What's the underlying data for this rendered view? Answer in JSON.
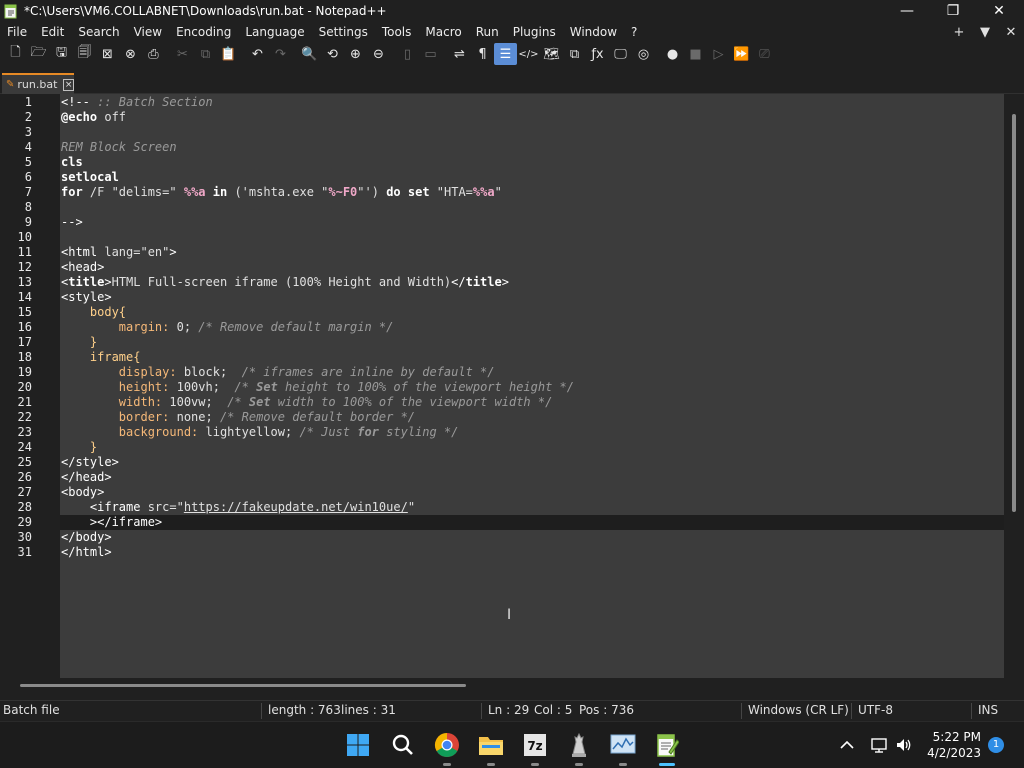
{
  "window": {
    "title": "*C:\\Users\\VM6.COLLABNET\\Downloads\\run.bat - Notepad++",
    "minimize_icon": "minimize-icon",
    "maximize_icon": "restore-icon",
    "close_icon": "close-icon"
  },
  "menu": {
    "items": [
      "File",
      "Edit",
      "Search",
      "View",
      "Encoding",
      "Language",
      "Settings",
      "Tools",
      "Macro",
      "Run",
      "Plugins",
      "Window",
      "?"
    ],
    "right": [
      "+",
      "▼",
      "✕"
    ]
  },
  "toolbar": {
    "buttons": [
      {
        "name": "new-file",
        "glyph": "🗋",
        "dim": false
      },
      {
        "name": "open-file",
        "glyph": "🗁",
        "dim": false
      },
      {
        "name": "save",
        "glyph": "🖫",
        "dim": false
      },
      {
        "name": "save-all",
        "glyph": "🗐",
        "dim": false
      },
      {
        "name": "close",
        "glyph": "⊠",
        "dim": false
      },
      {
        "name": "close-all",
        "glyph": "⊗",
        "dim": false
      },
      {
        "name": "print",
        "glyph": "⎙",
        "dim": false
      },
      {
        "name": "cut",
        "glyph": "✂",
        "dim": true
      },
      {
        "name": "copy",
        "glyph": "⧉",
        "dim": true
      },
      {
        "name": "paste",
        "glyph": "📋",
        "dim": false
      },
      {
        "name": "undo",
        "glyph": "↶",
        "dim": false
      },
      {
        "name": "redo",
        "glyph": "↷",
        "dim": true
      },
      {
        "name": "find",
        "glyph": "🔍",
        "dim": false
      },
      {
        "name": "replace",
        "glyph": "⟲",
        "dim": false
      },
      {
        "name": "zoom-in",
        "glyph": "⊕",
        "dim": false
      },
      {
        "name": "zoom-out",
        "glyph": "⊖",
        "dim": false
      },
      {
        "name": "sync-vertical",
        "glyph": "▯",
        "dim": true
      },
      {
        "name": "sync-horizontal",
        "glyph": "▭",
        "dim": true
      },
      {
        "name": "word-wrap",
        "glyph": "⇌",
        "dim": false
      },
      {
        "name": "show-all-chars",
        "glyph": "¶",
        "dim": false
      },
      {
        "name": "indent-guide",
        "glyph": "☰",
        "dim": false,
        "active": true
      },
      {
        "name": "udl",
        "glyph": "</>",
        "dim": false
      },
      {
        "name": "doc-map",
        "glyph": "🗺",
        "dim": false
      },
      {
        "name": "doc-list",
        "glyph": "⧉",
        "dim": false
      },
      {
        "name": "function-list",
        "glyph": "ƒx",
        "dim": false
      },
      {
        "name": "folder-as-workspace",
        "glyph": "🖵",
        "dim": false
      },
      {
        "name": "monitoring",
        "glyph": "◎",
        "dim": false
      },
      {
        "name": "record-macro",
        "glyph": "●",
        "dim": false
      },
      {
        "name": "stop-macro",
        "glyph": "■",
        "dim": true
      },
      {
        "name": "play-macro",
        "glyph": "▷",
        "dim": true
      },
      {
        "name": "run-macro-multiple",
        "glyph": "⏩",
        "dim": false
      },
      {
        "name": "save-macro",
        "glyph": "⎚",
        "dim": true
      }
    ]
  },
  "tab": {
    "label": "run.bat",
    "close_glyph": "×"
  },
  "editor": {
    "lines": [
      {
        "n": "1",
        "html": "<span class='tag'>&lt;!--</span><span class='cm'> :: Batch Section</span>"
      },
      {
        "n": "2",
        "html": "<span class='kw'>@echo</span> off"
      },
      {
        "n": "3",
        "html": ""
      },
      {
        "n": "4",
        "html": "<span class='cm'>REM Block Screen</span>"
      },
      {
        "n": "5",
        "html": "<span class='kw'>cls</span>"
      },
      {
        "n": "6",
        "html": "<span class='kw'>setlocal</span>"
      },
      {
        "n": "7",
        "html": "<span class='kw'>for</span> /F \"delims=\" <span class='var'>%%a</span> <span class='kw'>in</span> ('mshta.exe \"<span class='var'>%~F0</span>\"') <span class='kw'>do</span> <span class='kw'>set</span> \"HTA=<span class='var'>%%a</span>\""
      },
      {
        "n": "8",
        "html": ""
      },
      {
        "n": "9",
        "html": "<span class='tag'>--&gt;</span>"
      },
      {
        "n": "10",
        "html": ""
      },
      {
        "n": "11",
        "html": "<span class='tag'>&lt;html</span> lang=\"en\"<span class='tag'>&gt;</span>"
      },
      {
        "n": "12",
        "html": "<span class='tag'>&lt;head&gt;</span>"
      },
      {
        "n": "13",
        "html": "<span class='tag'>&lt;<b>title</b>&gt;</span>HTML Full-screen iframe (100% Height and Width)<span class='tag'>&lt;/<b>title</b>&gt;</span>"
      },
      {
        "n": "14",
        "html": "<span class='tag'>&lt;style&gt;</span>"
      },
      {
        "n": "15",
        "html": "    <span class='sel'>body{</span>"
      },
      {
        "n": "16",
        "html": "        <span class='prop'>margin:</span> 0; <span class='cm'>/* Remove default margin */</span>"
      },
      {
        "n": "17",
        "html": "    <span class='sel'>}</span>"
      },
      {
        "n": "18",
        "html": "    <span class='sel'>iframe{</span>"
      },
      {
        "n": "19",
        "html": "        <span class='prop'>display:</span> block;  <span class='cm'>/* iframes are inline by default */</span>"
      },
      {
        "n": "20",
        "html": "        <span class='prop'>height:</span> 100vh;  <span class='cm'>/* <b>Set</b> height to 100% of the viewport height */</span>"
      },
      {
        "n": "21",
        "html": "        <span class='prop'>width:</span> 100vw;  <span class='cm'>/* <b>Set</b> width to 100% of the viewport width */</span>"
      },
      {
        "n": "22",
        "html": "        <span class='prop'>border:</span> none; <span class='cm'>/* Remove default border */</span>"
      },
      {
        "n": "23",
        "html": "        <span class='prop'>background:</span> lightyellow; <span class='cm'>/* Just <b>for</b> styling */</span>"
      },
      {
        "n": "24",
        "html": "    <span class='sel'>}</span>"
      },
      {
        "n": "25",
        "html": "<span class='tag'>&lt;/style&gt;</span>"
      },
      {
        "n": "26",
        "html": "<span class='tag'>&lt;/head&gt;</span>"
      },
      {
        "n": "27",
        "html": "<span class='tag'>&lt;body&gt;</span>"
      },
      {
        "n": "28",
        "html": "    <span class='tag'>&lt;iframe</span> src=\"<span class='url'>https://fakeupdate.net/win10ue/</span>\""
      },
      {
        "n": "29",
        "html": "    <span class='tag'>&gt;&lt;/iframe&gt;</span>"
      },
      {
        "n": "30",
        "html": "<span class='tag'>&lt;/body&gt;</span>"
      },
      {
        "n": "31",
        "html": "<span class='tag'>&lt;/html&gt;</span>"
      }
    ],
    "current_line": 29,
    "modified_lines": [
      28,
      29
    ]
  },
  "status": {
    "file_type": "Batch file",
    "length": "length : 763",
    "lines": "lines : 31",
    "ln": "Ln : 29",
    "col": "Col : 5",
    "pos": "Pos : 736",
    "eol": "Windows (CR LF)",
    "encoding": "UTF-8",
    "mode": "INS"
  },
  "taskbar": {
    "icons": [
      "windows-start-icon",
      "search-icon",
      "chrome-icon",
      "file-explorer-icon",
      "7zip-icon",
      "chess-app-icon",
      "performance-monitor-icon",
      "notepadpp-icon"
    ],
    "time": "5:22 PM",
    "date": "4/2/2023",
    "notifications": "1"
  },
  "colors": {
    "accent": "#e78a25",
    "editor_bg": "#3c3c3c",
    "active_tool": "#5b8dd6",
    "taskbar_active": "#4cc2ff"
  }
}
